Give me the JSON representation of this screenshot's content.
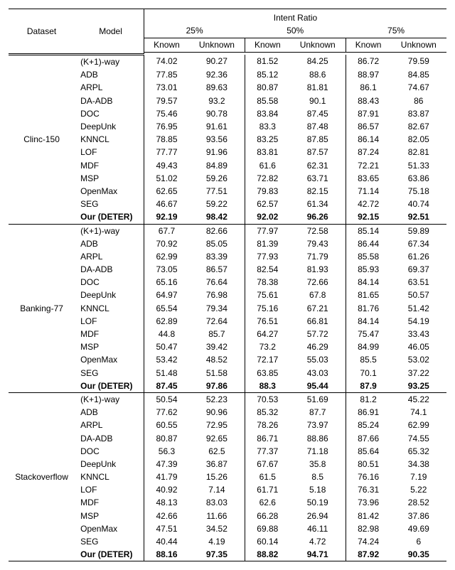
{
  "chart_data": {
    "type": "table",
    "title": "",
    "header": {
      "dataset": "Dataset",
      "model": "Model",
      "intent_ratio": "Intent Ratio",
      "ratios": [
        "25%",
        "50%",
        "75%"
      ],
      "known": "Known",
      "unknown": "Unknown"
    },
    "groups": [
      {
        "dataset": "Clinc-150",
        "rows": [
          {
            "model": "(K+1)-way",
            "bold": false,
            "v": [
              74.02,
              90.27,
              81.52,
              84.25,
              86.72,
              79.59
            ]
          },
          {
            "model": "ADB",
            "bold": false,
            "v": [
              77.85,
              92.36,
              85.12,
              88.6,
              88.97,
              84.85
            ]
          },
          {
            "model": "ARPL",
            "bold": false,
            "v": [
              73.01,
              89.63,
              80.87,
              81.81,
              86.1,
              74.67
            ]
          },
          {
            "model": "DA-ADB",
            "bold": false,
            "v": [
              79.57,
              93.2,
              85.58,
              90.1,
              88.43,
              86
            ]
          },
          {
            "model": "DOC",
            "bold": false,
            "v": [
              75.46,
              90.78,
              83.84,
              87.45,
              87.91,
              83.87
            ]
          },
          {
            "model": "DeepUnk",
            "bold": false,
            "v": [
              76.95,
              91.61,
              83.3,
              87.48,
              86.57,
              82.67
            ]
          },
          {
            "model": "KNNCL",
            "bold": false,
            "v": [
              78.85,
              93.56,
              83.25,
              87.85,
              86.14,
              82.05
            ]
          },
          {
            "model": "LOF",
            "bold": false,
            "v": [
              77.77,
              91.96,
              83.81,
              87.57,
              87.24,
              82.81
            ]
          },
          {
            "model": "MDF",
            "bold": false,
            "v": [
              49.43,
              84.89,
              61.6,
              62.31,
              72.21,
              51.33
            ]
          },
          {
            "model": "MSP",
            "bold": false,
            "v": [
              51.02,
              59.26,
              72.82,
              63.71,
              83.65,
              63.86
            ]
          },
          {
            "model": "OpenMax",
            "bold": false,
            "v": [
              62.65,
              77.51,
              79.83,
              82.15,
              71.14,
              75.18
            ]
          },
          {
            "model": "SEG",
            "bold": false,
            "v": [
              46.67,
              59.22,
              62.57,
              61.34,
              42.72,
              40.74
            ]
          },
          {
            "model": "Our (DETER)",
            "bold": true,
            "v": [
              92.19,
              98.42,
              92.02,
              96.26,
              92.15,
              92.51
            ]
          }
        ]
      },
      {
        "dataset": "Banking-77",
        "rows": [
          {
            "model": "(K+1)-way",
            "bold": false,
            "v": [
              67.7,
              82.66,
              77.97,
              72.58,
              85.14,
              59.89
            ]
          },
          {
            "model": "ADB",
            "bold": false,
            "v": [
              70.92,
              85.05,
              81.39,
              79.43,
              86.44,
              67.34
            ]
          },
          {
            "model": "ARPL",
            "bold": false,
            "v": [
              62.99,
              83.39,
              77.93,
              71.79,
              85.58,
              61.26
            ]
          },
          {
            "model": "DA-ADB",
            "bold": false,
            "v": [
              73.05,
              86.57,
              82.54,
              81.93,
              85.93,
              69.37
            ]
          },
          {
            "model": "DOC",
            "bold": false,
            "v": [
              65.16,
              76.64,
              78.38,
              72.66,
              84.14,
              63.51
            ]
          },
          {
            "model": "DeepUnk",
            "bold": false,
            "v": [
              64.97,
              76.98,
              75.61,
              67.8,
              81.65,
              50.57
            ]
          },
          {
            "model": "KNNCL",
            "bold": false,
            "v": [
              65.54,
              79.34,
              75.16,
              67.21,
              81.76,
              51.42
            ]
          },
          {
            "model": "LOF",
            "bold": false,
            "v": [
              62.89,
              72.64,
              76.51,
              66.81,
              84.14,
              54.19
            ]
          },
          {
            "model": "MDF",
            "bold": false,
            "v": [
              44.8,
              85.7,
              64.27,
              57.72,
              75.47,
              33.43
            ]
          },
          {
            "model": "MSP",
            "bold": false,
            "v": [
              50.47,
              39.42,
              73.2,
              46.29,
              84.99,
              46.05
            ]
          },
          {
            "model": "OpenMax",
            "bold": false,
            "v": [
              53.42,
              48.52,
              72.17,
              55.03,
              85.5,
              53.02
            ]
          },
          {
            "model": "SEG",
            "bold": false,
            "v": [
              51.48,
              51.58,
              63.85,
              43.03,
              70.1,
              37.22
            ]
          },
          {
            "model": "Our (DETER)",
            "bold": true,
            "v": [
              87.45,
              97.86,
              88.3,
              95.44,
              87.9,
              93.25
            ]
          }
        ]
      },
      {
        "dataset": "Stackoverflow",
        "rows": [
          {
            "model": "(K+1)-way",
            "bold": false,
            "v": [
              50.54,
              52.23,
              70.53,
              51.69,
              81.2,
              45.22
            ]
          },
          {
            "model": "ADB",
            "bold": false,
            "v": [
              77.62,
              90.96,
              85.32,
              87.7,
              86.91,
              74.1
            ]
          },
          {
            "model": "ARPL",
            "bold": false,
            "v": [
              60.55,
              72.95,
              78.26,
              73.97,
              85.24,
              62.99
            ]
          },
          {
            "model": "DA-ADB",
            "bold": false,
            "v": [
              80.87,
              92.65,
              86.71,
              88.86,
              87.66,
              74.55
            ]
          },
          {
            "model": "DOC",
            "bold": false,
            "v": [
              56.3,
              62.5,
              77.37,
              71.18,
              85.64,
              65.32
            ]
          },
          {
            "model": "DeepUnk",
            "bold": false,
            "v": [
              47.39,
              36.87,
              67.67,
              35.8,
              80.51,
              34.38
            ]
          },
          {
            "model": "KNNCL",
            "bold": false,
            "v": [
              41.79,
              15.26,
              61.5,
              8.5,
              76.16,
              7.19
            ]
          },
          {
            "model": "LOF",
            "bold": false,
            "v": [
              40.92,
              7.14,
              61.71,
              5.18,
              76.31,
              5.22
            ]
          },
          {
            "model": "MDF",
            "bold": false,
            "v": [
              48.13,
              83.03,
              62.6,
              50.19,
              73.96,
              28.52
            ]
          },
          {
            "model": "MSP",
            "bold": false,
            "v": [
              42.66,
              11.66,
              66.28,
              26.94,
              81.42,
              37.86
            ]
          },
          {
            "model": "OpenMax",
            "bold": false,
            "v": [
              47.51,
              34.52,
              69.88,
              46.11,
              82.98,
              49.69
            ]
          },
          {
            "model": "SEG",
            "bold": false,
            "v": [
              40.44,
              4.19,
              60.14,
              4.72,
              74.24,
              6
            ]
          },
          {
            "model": "Our (DETER)",
            "bold": true,
            "v": [
              88.16,
              97.35,
              88.82,
              94.71,
              87.92,
              90.35
            ]
          }
        ]
      }
    ]
  }
}
